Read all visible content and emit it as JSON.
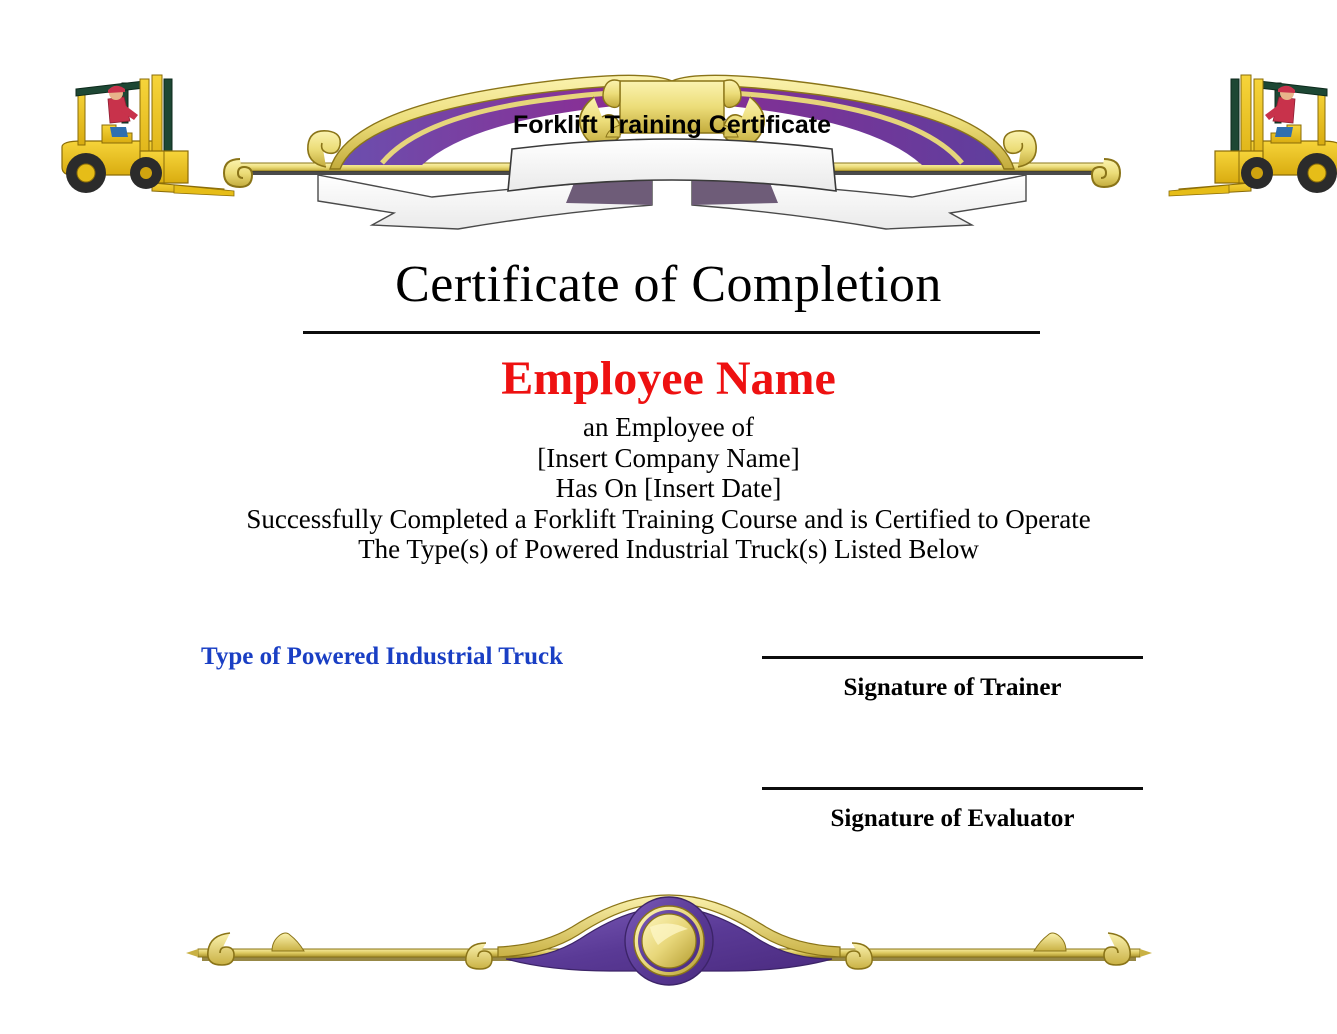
{
  "document": {
    "type": "certificate",
    "background_color": "#ffffff"
  },
  "header": {
    "banner_title": "Forklift Training Certificate",
    "banner_colors": {
      "purple_dark": "#7d2a8f",
      "purple_light": "#6c4fae",
      "gold": "#e9dd7e",
      "gold_dark": "#b9a436",
      "ribbon": "#f7f7f7"
    },
    "left_graphic": "forklift-icon",
    "right_graphic": "forklift-icon",
    "forklift_colors": {
      "body": "#f2c61c",
      "body_dark": "#c99f10",
      "mast": "#1d4734",
      "tire": "#2b2b2b",
      "operator_shirt": "#c8324b",
      "operator_cap": "#c8324b",
      "operator_pants": "#2f6fb0"
    }
  },
  "main": {
    "title": "Certificate of Completion",
    "employee_name": "Employee Name",
    "employee_name_color": "#ee1111",
    "body_lines": [
      "an Employee of",
      "[Insert Company Name]",
      "Has On [Insert Date]",
      "Successfully Completed a Forklift Training Course and is Certified to Operate",
      "The Type(s) of Powered Industrial Truck(s) Listed Below"
    ]
  },
  "truck_type": {
    "label": "Type of Powered Industrial Truck",
    "color": "#1a3fc4"
  },
  "signatures": [
    {
      "label": "Signature of Trainer"
    },
    {
      "label": "Signature of Evaluator"
    }
  ],
  "footer": {
    "ornament": "gold-medallion-divider",
    "ornament_colors": {
      "gold": "#e9dd7e",
      "gold_dark": "#b09a2e",
      "purple": "#6c4fae",
      "purple_dark": "#4f2d7f"
    }
  }
}
